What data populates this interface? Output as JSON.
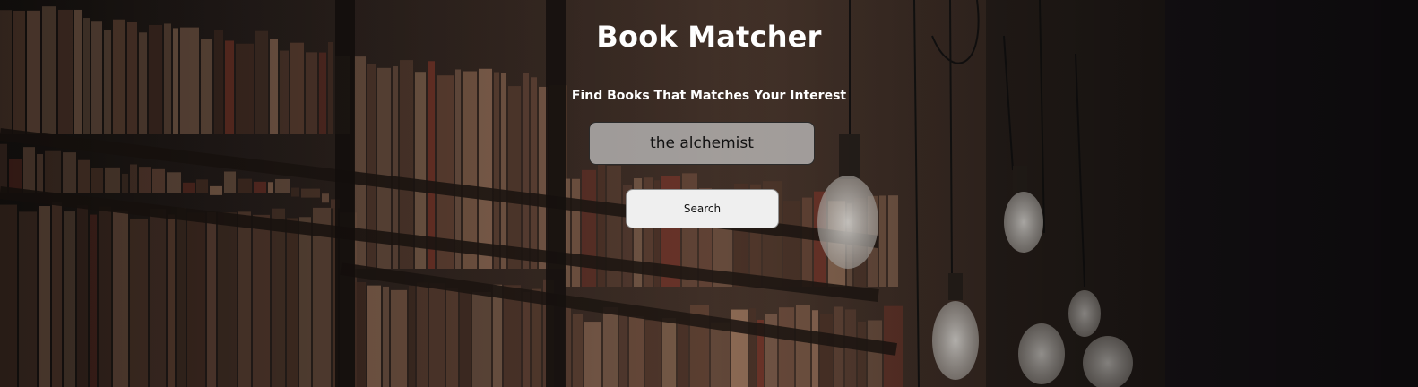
{
  "header": {
    "title": "Book Matcher",
    "subtitle": "Find Books That Matches Your Interest"
  },
  "search": {
    "value": "the alchemist",
    "button_label": "Search"
  },
  "colors": {
    "title_text": "#ffffff",
    "input_background": "#c8c8c8",
    "button_background": "#efefef"
  }
}
